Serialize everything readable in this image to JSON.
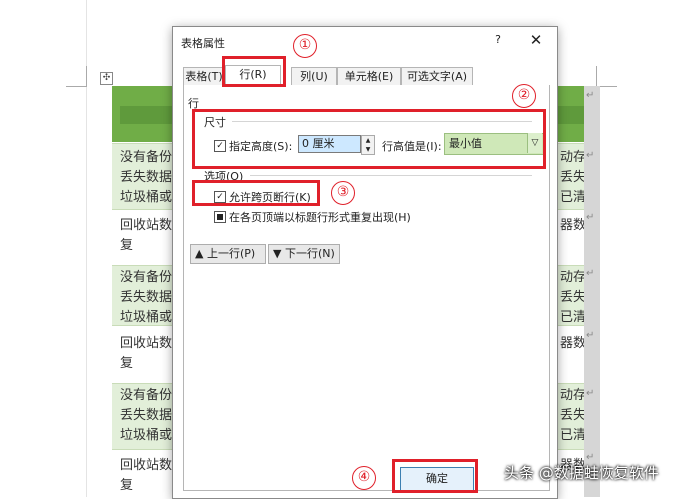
{
  "document": {
    "rows": [
      {
        "left": "没有备份\n丢失数据,\n垃圾桶或",
        "right": "动存\n丢失\n已清"
      },
      {
        "left": "回收站数\n复",
        "right": "器数"
      },
      {
        "left": "没有备份\n丢失数据,\n垃圾桶或",
        "right": "动存\n丢失\n已清"
      },
      {
        "left": "回收站数\n复",
        "right": "器数"
      },
      {
        "left": "没有备份\n丢失数据,\n垃圾桶或",
        "right": "动存\n丢失\n已清"
      },
      {
        "left": "回收站数\n复",
        "right": "器数"
      }
    ],
    "paragraph_mark": "↵",
    "anchor_glyph": "✣"
  },
  "dialog": {
    "title": "表格属性",
    "help": "?",
    "close": "✕",
    "tabs": [
      {
        "label": "表格(T)"
      },
      {
        "label": "行(R)"
      },
      {
        "label": "列(U)"
      },
      {
        "label": "单元格(E)"
      },
      {
        "label": "可选文字(A)"
      }
    ],
    "row_heading": "行",
    "size_group": "尺寸",
    "specify_height_label": "指定高度(S):",
    "height_value": "0 厘米",
    "row_height_is_label": "行高值是(I):",
    "row_height_is_value": "最小值",
    "options_group": "选项(O)",
    "allow_break_label": "允许跨页断行(K)",
    "repeat_header_label": "在各页顶端以标题行形式重复出现(H)",
    "prev_row_button": "▲ 上一行(P)",
    "next_row_button": "▼ 下一行(N)",
    "ok_button": "确定"
  },
  "annotations": {
    "markers": [
      "①",
      "②",
      "③",
      "④"
    ],
    "color": "#e0202a"
  },
  "watermark": "头条 @数据蛙恢复软件",
  "colors": {
    "header_green": "#70ad47",
    "row_green": "#e2efd9",
    "selected_input": "#cde8ff",
    "select_green": "#cfe8b8"
  }
}
